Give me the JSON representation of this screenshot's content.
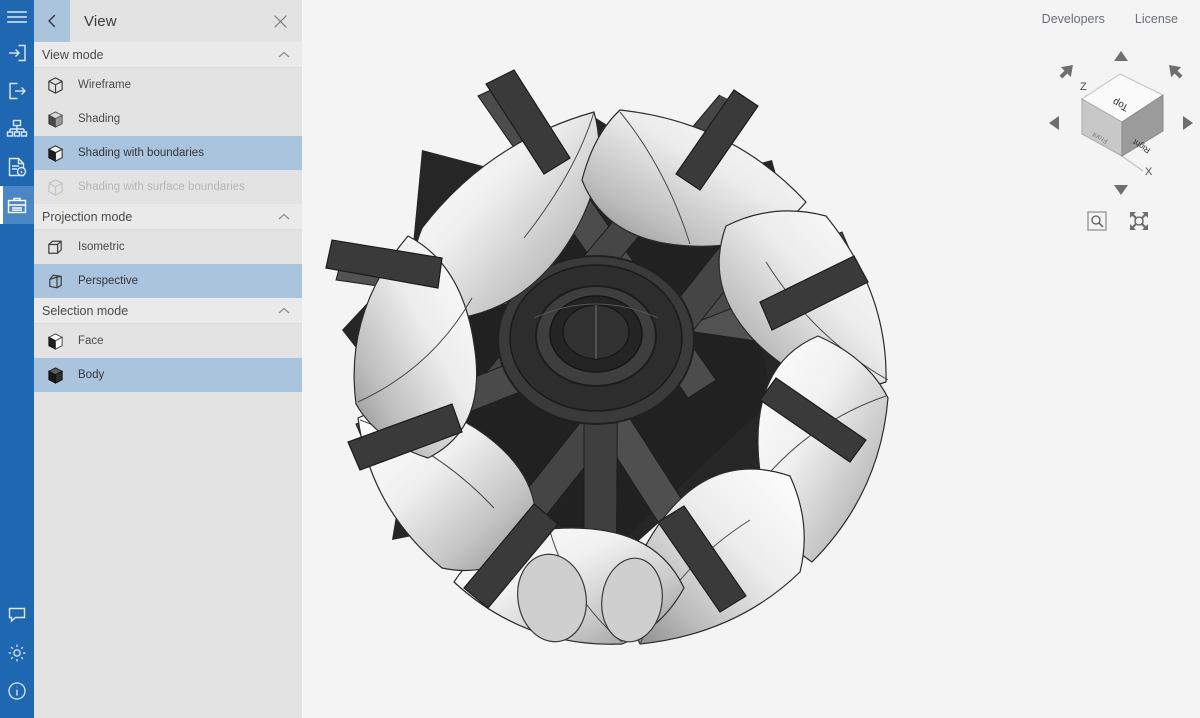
{
  "app": {
    "accent_blue": "#1f67b0",
    "accent_blue_active": "#4a87c4",
    "selection_blue": "#a9c4dc",
    "panel_bg": "#e3e3e3",
    "section_bg": "#eaeaea",
    "viewport_bg": "#f4f4f4",
    "text_color": "#4a4a4a"
  },
  "rail": {
    "items": [
      {
        "name": "menu-icon",
        "label": "Menu",
        "active": false
      },
      {
        "name": "import-icon",
        "label": "Import",
        "active": false
      },
      {
        "name": "export-icon",
        "label": "Export",
        "active": false
      },
      {
        "name": "structure-icon",
        "label": "Structure",
        "active": false
      },
      {
        "name": "properties-icon",
        "label": "Properties",
        "active": false
      },
      {
        "name": "toolbox-icon",
        "label": "View",
        "active": true
      }
    ],
    "bottom_items": [
      {
        "name": "comment-icon",
        "label": "Feedback"
      },
      {
        "name": "gear-icon",
        "label": "Settings"
      },
      {
        "name": "info-icon",
        "label": "About"
      }
    ]
  },
  "panel": {
    "title": "View",
    "back_label": "Back",
    "close_label": "Close",
    "sections": [
      {
        "id": "view-mode",
        "title": "View mode",
        "collapsed": false,
        "options": [
          {
            "label": "Wireframe",
            "icon": "cube-wireframe-icon",
            "selected": false,
            "disabled": false
          },
          {
            "label": "Shading",
            "icon": "cube-shaded-icon",
            "selected": false,
            "disabled": false
          },
          {
            "label": "Shading with boundaries",
            "icon": "cube-shaded-edges-icon",
            "selected": true,
            "disabled": false
          },
          {
            "label": "Shading with surface boundaries",
            "icon": "cube-surface-edges-icon",
            "selected": false,
            "disabled": true
          }
        ]
      },
      {
        "id": "projection-mode",
        "title": "Projection mode",
        "collapsed": false,
        "options": [
          {
            "label": "Isometric",
            "icon": "cube-isometric-icon",
            "selected": false,
            "disabled": false
          },
          {
            "label": "Perspective",
            "icon": "cube-perspective-icon",
            "selected": true,
            "disabled": false
          }
        ]
      },
      {
        "id": "selection-mode",
        "title": "Selection mode",
        "collapsed": false,
        "options": [
          {
            "label": "Face",
            "icon": "cube-face-icon",
            "selected": false,
            "disabled": false
          },
          {
            "label": "Body",
            "icon": "cube-body-icon",
            "selected": true,
            "disabled": false
          }
        ]
      }
    ]
  },
  "topnav": {
    "links": [
      {
        "label": "Developers"
      },
      {
        "label": "License"
      }
    ]
  },
  "navcube": {
    "faces": {
      "top": "Top",
      "right": "Right",
      "front": "Front"
    },
    "axes": {
      "vertical": "Z",
      "horizontal": "X"
    },
    "arrows": [
      "up",
      "down",
      "left",
      "right",
      "up-left",
      "up-right"
    ],
    "tools": [
      {
        "name": "zoom-window-icon",
        "label": "Zoom to window"
      },
      {
        "name": "fit-all-icon",
        "label": "Fit all"
      }
    ]
  },
  "viewport": {
    "model_name": "omni-wheel",
    "description": "Shaded CAD model of an omnidirectional wheel with conical rollers and a dark spoked hub"
  }
}
